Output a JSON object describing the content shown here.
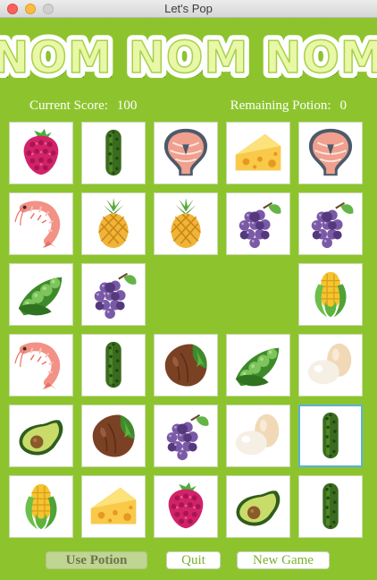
{
  "window": {
    "title": "Let's Pop"
  },
  "game": {
    "title": "NOM NOM NOM",
    "score_label": "Current Score:",
    "score": "100",
    "potion_label": "Remaining Potion:",
    "potion": "0"
  },
  "board": {
    "rows": 6,
    "cols": 5,
    "cells": [
      [
        "raspberry",
        "pickle",
        "salmon",
        "cheese",
        "salmon"
      ],
      [
        "shrimp",
        "pineapple",
        "pineapple",
        "grapes",
        "grapes"
      ],
      [
        "peas",
        "grapes",
        null,
        null,
        "corn"
      ],
      [
        "shrimp",
        "pickle",
        "hazelnut",
        "peas",
        "eggs"
      ],
      [
        "avocado",
        "hazelnut",
        "grapes",
        "eggs",
        "pickle"
      ],
      [
        "corn",
        "cheese",
        "raspberry",
        "avocado",
        "pickle"
      ]
    ],
    "selected": {
      "row": 4,
      "col": 4
    }
  },
  "buttons": {
    "use_potion": "Use Potion",
    "quit": "Quit",
    "new_game": "New Game"
  }
}
